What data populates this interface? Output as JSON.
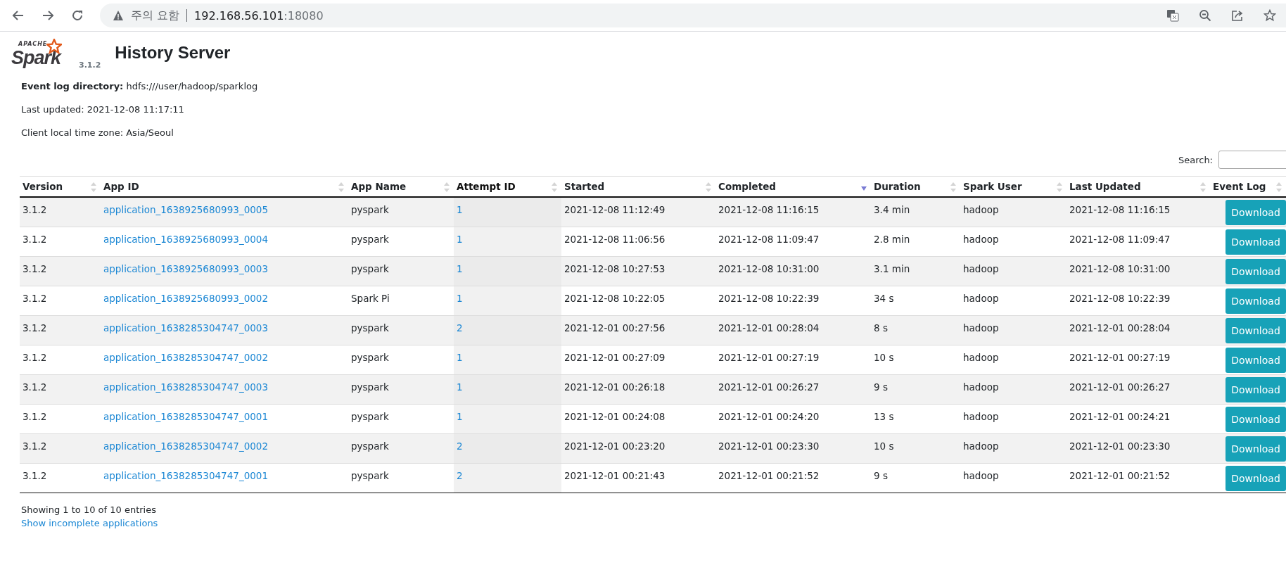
{
  "browser": {
    "address": {
      "warning": "주의 요함",
      "host": "192.168.56.101",
      "port": ":18080"
    }
  },
  "header": {
    "logo": {
      "small": "APACHE",
      "brand": "Spark"
    },
    "version": "3.1.2",
    "title": "History Server"
  },
  "info": {
    "event_log_label": "Event log directory:",
    "event_log_value": "hdfs:///user/hadoop/sparklog",
    "last_updated": "Last updated: 2021-12-08 11:17:11",
    "time_zone": "Client local time zone: Asia/Seoul"
  },
  "search": {
    "label": "Search:"
  },
  "table": {
    "columns": [
      {
        "label": "Version",
        "sorted_desc": false,
        "shaded": false
      },
      {
        "label": "App ID",
        "sorted_desc": false,
        "shaded": false
      },
      {
        "label": "App Name",
        "sorted_desc": false,
        "shaded": false
      },
      {
        "label": "Attempt ID",
        "sorted_desc": false,
        "shaded": true
      },
      {
        "label": "Started",
        "sorted_desc": false,
        "shaded": false
      },
      {
        "label": "Completed",
        "sorted_desc": true,
        "shaded": false
      },
      {
        "label": "Duration",
        "sorted_desc": false,
        "shaded": false
      },
      {
        "label": "Spark User",
        "sorted_desc": false,
        "shaded": false
      },
      {
        "label": "Last Updated",
        "sorted_desc": false,
        "shaded": false
      },
      {
        "label": "Event Log",
        "sorted_desc": false,
        "shaded": false
      }
    ],
    "rows": [
      {
        "version": "3.1.2",
        "app_id": "application_1638925680993_0005",
        "app_name": "pyspark",
        "attempt": "1",
        "started": "2021-12-08 11:12:49",
        "completed": "2021-12-08 11:16:15",
        "duration": "3.4 min",
        "user": "hadoop",
        "last_updated": "2021-12-08 11:16:15",
        "action": "Download"
      },
      {
        "version": "3.1.2",
        "app_id": "application_1638925680993_0004",
        "app_name": "pyspark",
        "attempt": "1",
        "started": "2021-12-08 11:06:56",
        "completed": "2021-12-08 11:09:47",
        "duration": "2.8 min",
        "user": "hadoop",
        "last_updated": "2021-12-08 11:09:47",
        "action": "Download"
      },
      {
        "version": "3.1.2",
        "app_id": "application_1638925680993_0003",
        "app_name": "pyspark",
        "attempt": "1",
        "started": "2021-12-08 10:27:53",
        "completed": "2021-12-08 10:31:00",
        "duration": "3.1 min",
        "user": "hadoop",
        "last_updated": "2021-12-08 10:31:00",
        "action": "Download"
      },
      {
        "version": "3.1.2",
        "app_id": "application_1638925680993_0002",
        "app_name": "Spark Pi",
        "attempt": "1",
        "started": "2021-12-08 10:22:05",
        "completed": "2021-12-08 10:22:39",
        "duration": "34 s",
        "user": "hadoop",
        "last_updated": "2021-12-08 10:22:39",
        "action": "Download"
      },
      {
        "version": "3.1.2",
        "app_id": "application_1638285304747_0003",
        "app_name": "pyspark",
        "attempt": "2",
        "started": "2021-12-01 00:27:56",
        "completed": "2021-12-01 00:28:04",
        "duration": "8 s",
        "user": "hadoop",
        "last_updated": "2021-12-01 00:28:04",
        "action": "Download"
      },
      {
        "version": "3.1.2",
        "app_id": "application_1638285304747_0002",
        "app_name": "pyspark",
        "attempt": "1",
        "started": "2021-12-01 00:27:09",
        "completed": "2021-12-01 00:27:19",
        "duration": "10 s",
        "user": "hadoop",
        "last_updated": "2021-12-01 00:27:19",
        "action": "Download"
      },
      {
        "version": "3.1.2",
        "app_id": "application_1638285304747_0003",
        "app_name": "pyspark",
        "attempt": "1",
        "started": "2021-12-01 00:26:18",
        "completed": "2021-12-01 00:26:27",
        "duration": "9 s",
        "user": "hadoop",
        "last_updated": "2021-12-01 00:26:27",
        "action": "Download"
      },
      {
        "version": "3.1.2",
        "app_id": "application_1638285304747_0001",
        "app_name": "pyspark",
        "attempt": "1",
        "started": "2021-12-01 00:24:08",
        "completed": "2021-12-01 00:24:20",
        "duration": "13 s",
        "user": "hadoop",
        "last_updated": "2021-12-01 00:24:21",
        "action": "Download"
      },
      {
        "version": "3.1.2",
        "app_id": "application_1638285304747_0002",
        "app_name": "pyspark",
        "attempt": "2",
        "started": "2021-12-01 00:23:20",
        "completed": "2021-12-01 00:23:30",
        "duration": "10 s",
        "user": "hadoop",
        "last_updated": "2021-12-01 00:23:30",
        "action": "Download"
      },
      {
        "version": "3.1.2",
        "app_id": "application_1638285304747_0001",
        "app_name": "pyspark",
        "attempt": "2",
        "started": "2021-12-01 00:21:43",
        "completed": "2021-12-01 00:21:52",
        "duration": "9 s",
        "user": "hadoop",
        "last_updated": "2021-12-01 00:21:52",
        "action": "Download"
      }
    ]
  },
  "footer": {
    "summary": "Showing 1 to 10 of 10 entries",
    "link": "Show incomplete applications"
  }
}
